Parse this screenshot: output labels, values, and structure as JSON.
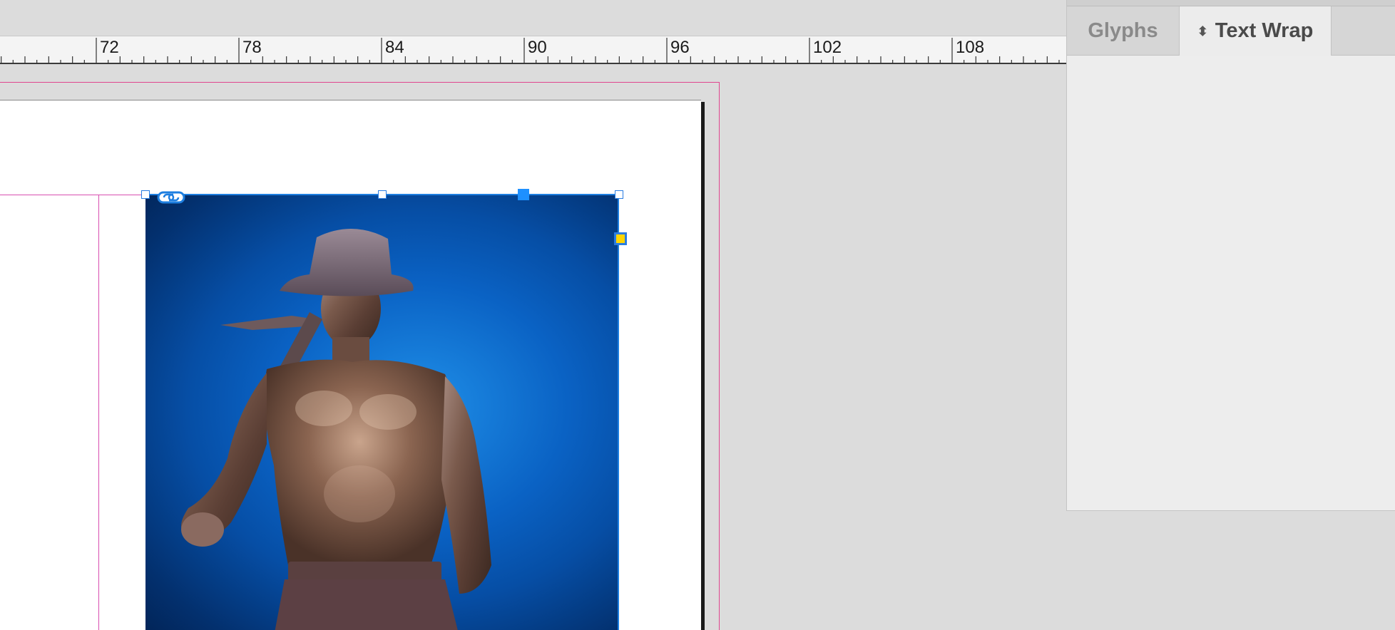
{
  "ruler": {
    "labels": [
      "72",
      "78",
      "84",
      "90",
      "96",
      "102",
      "108"
    ]
  },
  "panel": {
    "tabs": [
      {
        "label": "Glyphs",
        "active": false
      },
      {
        "label": "Text Wrap",
        "active": true,
        "icon": "chevron-updown-icon"
      }
    ]
  },
  "document": {
    "image_description_icon": "link-icon",
    "colors": {
      "bleed": "#e0468f",
      "margin": "#d84fb0",
      "selection": "#1e90ff",
      "handle_yellow": "#ffd500"
    }
  }
}
